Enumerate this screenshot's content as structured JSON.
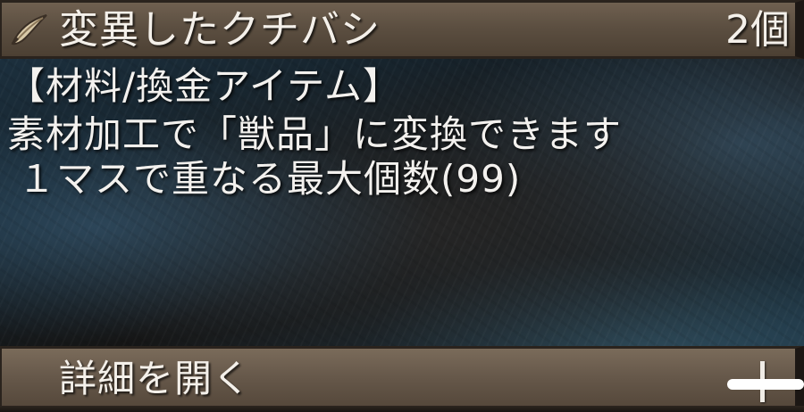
{
  "item": {
    "icon": "beak-icon",
    "name": "変異したクチバシ",
    "count": "2個"
  },
  "description": {
    "category": "【材料/換金アイテム】",
    "line1": "素材加工で「獣品」に変換できます",
    "line2": "１マスで重なる最大個数(99)"
  },
  "footer": {
    "details_label": "詳細を開く",
    "expand_icon": "plus-icon"
  },
  "colors": {
    "text": "#f4f0ea",
    "panel": "#6a5b4b"
  }
}
